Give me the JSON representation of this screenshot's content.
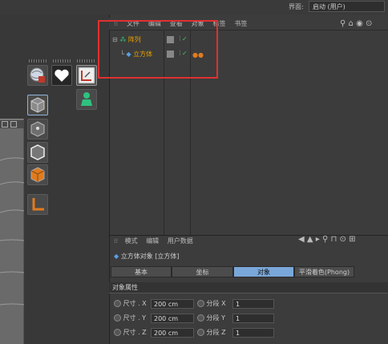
{
  "topbar": {
    "interface_label": "界面:",
    "interface_value": "启动 (用户)"
  },
  "object_manager": {
    "menu": [
      "文件",
      "编辑",
      "查看",
      "对象",
      "标签",
      "书签"
    ],
    "objects": [
      {
        "name": "阵列",
        "check": "✓"
      },
      {
        "name": "立方体",
        "check": "✓"
      }
    ]
  },
  "attributes": {
    "menu": [
      "模式",
      "编辑",
      "用户数据"
    ],
    "title": "立方体对象 [立方体]",
    "tabs": [
      "基本",
      "坐标",
      "对象",
      "平滑着色(Phong)"
    ],
    "active_tab": "对象",
    "section": "对象属性",
    "fields": [
      {
        "label": "尺寸 . X",
        "value": "200 cm",
        "seg_label": "分段 X",
        "seg_value": "1"
      },
      {
        "label": "尺寸 . Y",
        "value": "200 cm",
        "seg_label": "分段 Y",
        "seg_value": "1"
      },
      {
        "label": "尺寸 . Z",
        "value": "200 cm",
        "seg_label": "分段 Z",
        "seg_value": "1"
      }
    ]
  }
}
